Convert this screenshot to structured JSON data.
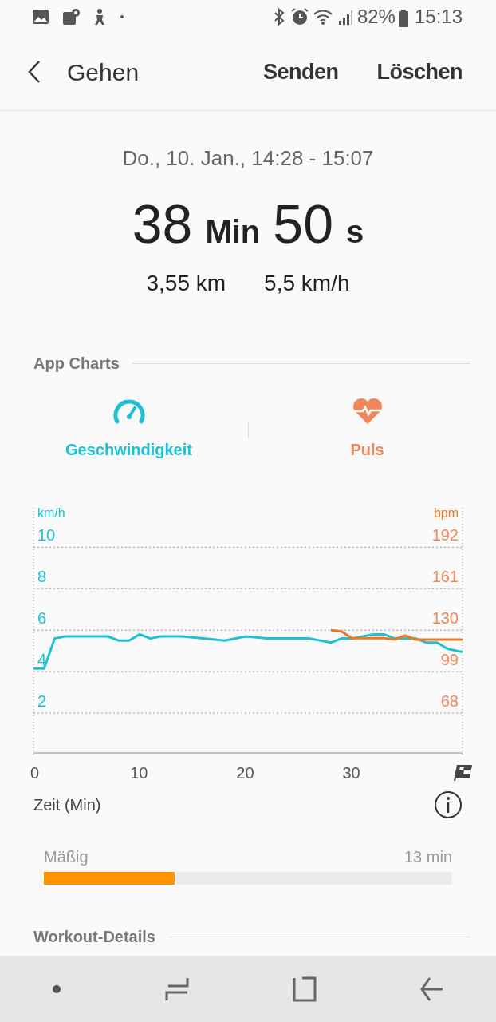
{
  "status_bar": {
    "battery": "82%",
    "time": "15:13"
  },
  "app_bar": {
    "title": "Gehen",
    "actions": [
      "Senden",
      "Löschen"
    ]
  },
  "summary": {
    "date": "Do., 10. Jan., 14:28 - 15:07",
    "duration": [
      {
        "kind": "number",
        "text": "38"
      },
      {
        "kind": "unit",
        "text": "Min"
      },
      {
        "kind": "number",
        "text": "50"
      },
      {
        "kind": "unit",
        "text": "s"
      }
    ],
    "distance": "3,55 km",
    "speed": "5,5 km/h"
  },
  "app_charts": {
    "title": "App Charts",
    "tabs": [
      {
        "kind": "speed",
        "label": "Geschwindigkeit",
        "selected": true,
        "color": "#1ec0d4"
      },
      {
        "kind": "heart",
        "label": "Puls",
        "selected": true,
        "color": "#f0875c"
      }
    ],
    "chart": {
      "right_ticks": [
        "192",
        "161",
        "130",
        "99",
        "68"
      ],
      "x_title": "Zeit (Min)",
      "chart_data": {
        "type": "line",
        "x": [
          0,
          1,
          2,
          3,
          5,
          7,
          8,
          9,
          10,
          11,
          12,
          14,
          16,
          18,
          20,
          22,
          24,
          26,
          28,
          29,
          30,
          32,
          33,
          34,
          35,
          36,
          37,
          38,
          39,
          40.4
        ],
        "series": [
          {
            "name": "km/h",
            "color": "#1ec0d4",
            "values": [
              4.15,
              4.15,
              5.6,
              5.7,
              5.7,
              5.7,
              5.5,
              5.5,
              5.8,
              5.6,
              5.7,
              5.7,
              5.6,
              5.5,
              5.7,
              5.6,
              5.6,
              5.6,
              5.4,
              5.6,
              5.6,
              5.8,
              5.8,
              5.6,
              5.6,
              5.6,
              5.4,
              5.4,
              5.1,
              4.95
            ]
          },
          {
            "name": "bpm",
            "color": "#f07820",
            "values": [
              null,
              null,
              null,
              null,
              null,
              null,
              null,
              null,
              null,
              null,
              null,
              null,
              null,
              null,
              null,
              null,
              null,
              null,
              6,
              5.94,
              5.61,
              5.61,
              5.61,
              5.55,
              5.74,
              5.55,
              5.55,
              5.55,
              5.55,
              5.55
            ]
          }
        ],
        "grid": true,
        "xlim": [
          0,
          40.4
        ],
        "ylim": [
          0,
          11.9
        ],
        "xticks": [
          0,
          10,
          20,
          30
        ],
        "yticks": [
          2,
          4,
          6,
          8,
          10
        ]
      }
    }
  },
  "intensity": {
    "label": "Mäßig",
    "value": "13 min",
    "level": 0.32
  },
  "workout_details": {
    "title": "Workout-Details"
  }
}
